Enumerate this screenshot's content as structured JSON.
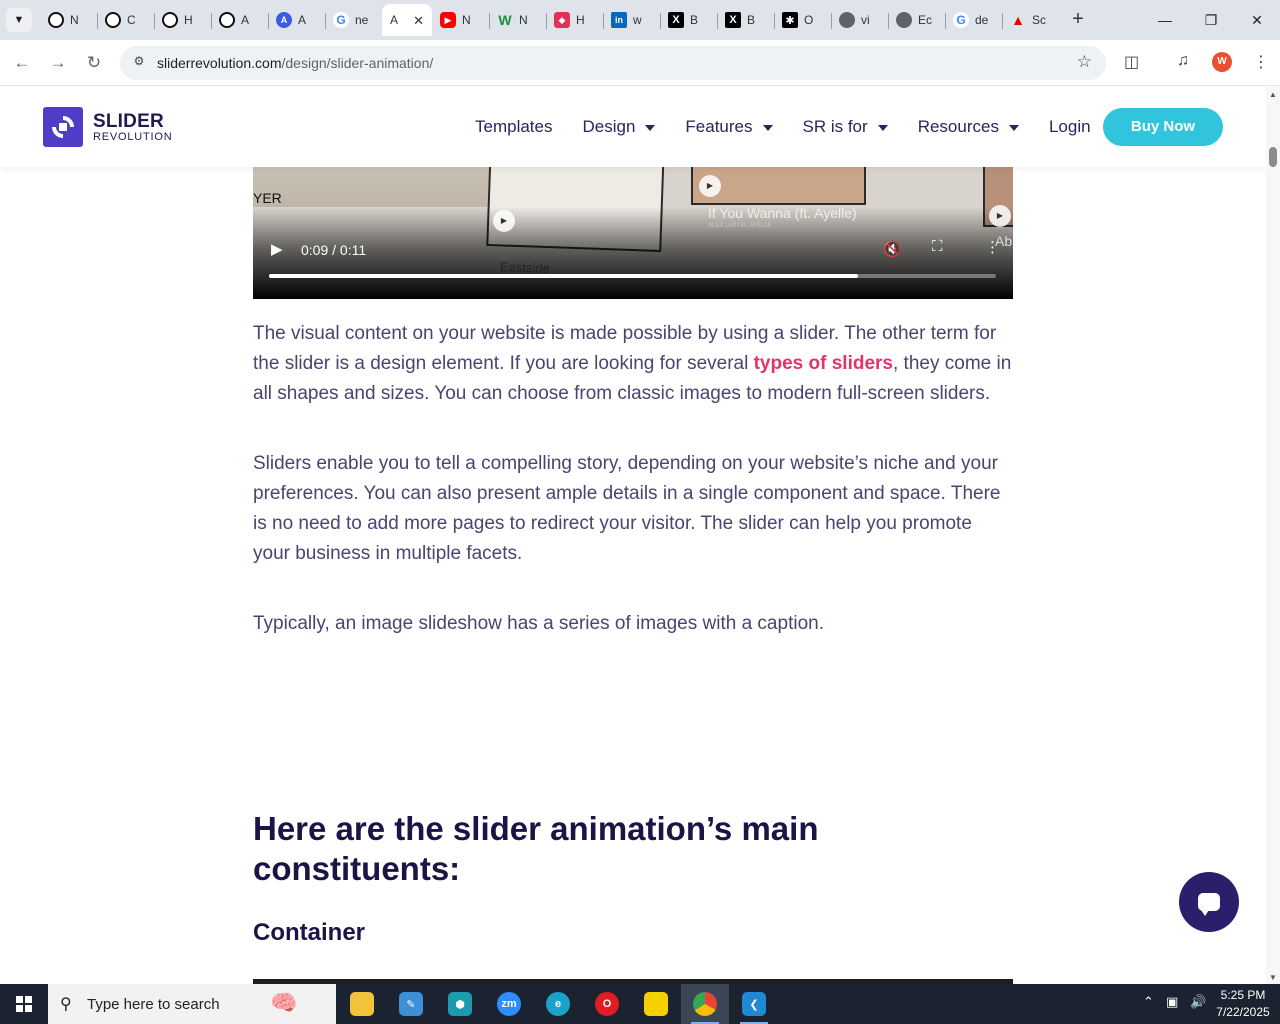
{
  "browser": {
    "tabs": [
      {
        "label": "N",
        "icon": "openai-icon"
      },
      {
        "label": "C",
        "icon": "openai-icon"
      },
      {
        "label": "H",
        "icon": "openai-icon"
      },
      {
        "label": "A",
        "icon": "openai-icon"
      },
      {
        "label": "A",
        "icon": "ai-icon"
      },
      {
        "label": "ne",
        "icon": "google-icon"
      },
      {
        "label": "A",
        "icon": "slider-revolution-icon",
        "active": true
      },
      {
        "label": "N",
        "icon": "youtube-icon"
      },
      {
        "label": "N",
        "icon": "w-icon"
      },
      {
        "label": "H",
        "icon": "tag-icon"
      },
      {
        "label": "w",
        "icon": "linkedin-icon"
      },
      {
        "label": "B",
        "icon": "x-icon"
      },
      {
        "label": "B",
        "icon": "x-icon"
      },
      {
        "label": "O",
        "icon": "bolt-icon"
      },
      {
        "label": "vi",
        "icon": "globe-icon"
      },
      {
        "label": "Ec",
        "icon": "globe-icon"
      },
      {
        "label": "de",
        "icon": "google-icon"
      },
      {
        "label": "Sc",
        "icon": "adobe-icon"
      }
    ],
    "url_host": "sliderrevolution.com",
    "url_path": "/design/slider-animation/",
    "profile_initial": "W"
  },
  "site": {
    "logo_title": "SLIDER",
    "logo_subtitle": "REVOLUTION",
    "nav": [
      "Templates",
      "Design",
      "Features",
      "SR is for",
      "Resources",
      "Login"
    ],
    "buy_label": "Buy Now"
  },
  "video": {
    "time": "0:09 / 0:11",
    "progress": 0.81,
    "caption_left": "YER",
    "caption_eastside": "Eastside",
    "caption_song": "If You Wanna (ft. Ayelle)",
    "caption_artist": "ALEX LUSTIG, AYELLE",
    "caption_right": "Ab"
  },
  "article": {
    "p1_before": "The visual content on your website is made possible by using a slider. The other term for the slider is a design element. If you are looking for several ",
    "p1_link": "types of sliders",
    "p1_after": ", they come in all shapes and sizes. You can choose from classic images to modern full-screen sliders.",
    "p2": "Sliders enable you to tell a compelling story, depending on your website’s niche and your preferences. You can also present ample details in a single component and space. There is no need to add more pages to redirect your visitor. The slider can help you promote your business in multiple facets.",
    "p3": "Typically, an image slideshow has a series of images with a caption.",
    "heading": "Here are the slider animation’s main constituents:",
    "subheading": "Container"
  },
  "taskbar": {
    "search_placeholder": "Type here to search",
    "time": "5:25 PM",
    "date": "7/22/2025"
  },
  "colors": {
    "accent": "#30c5dd",
    "link": "#e4336b",
    "brand": "#4f3cc9",
    "heading": "#1b1444"
  }
}
